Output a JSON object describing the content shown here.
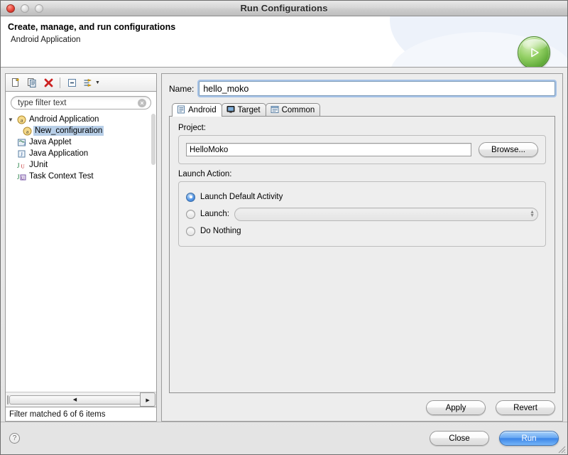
{
  "window": {
    "title": "Run Configurations",
    "controls": {
      "close": "close-button",
      "minimize": "minimize-button",
      "zoom": "zoom-button"
    }
  },
  "header": {
    "title": "Create, manage, and run configurations",
    "subtitle": "Android Application",
    "badge_icon": "run-play-icon"
  },
  "left_panel": {
    "toolbar": [
      {
        "name": "new-configuration-icon",
        "tooltip": "New launch configuration"
      },
      {
        "name": "duplicate-configuration-icon",
        "tooltip": "Duplicate"
      },
      {
        "name": "delete-configuration-icon",
        "tooltip": "Delete"
      },
      {
        "name": "collapse-all-icon",
        "tooltip": "Collapse All"
      },
      {
        "name": "filter-icon",
        "tooltip": "Filter"
      }
    ],
    "filter": {
      "placeholder": "type filter text",
      "value": "",
      "clear_icon": "clear-icon"
    },
    "tree": [
      {
        "label": "Android Application",
        "icon": "android-config-icon",
        "expanded": true,
        "indent": 0,
        "selected": false
      },
      {
        "label": "New_configuration",
        "icon": "android-config-icon",
        "expanded": false,
        "indent": 1,
        "selected": true
      },
      {
        "label": "Java Applet",
        "icon": "java-applet-icon",
        "expanded": false,
        "indent": 0,
        "selected": false
      },
      {
        "label": "Java Application",
        "icon": "java-application-icon",
        "expanded": false,
        "indent": 0,
        "selected": false
      },
      {
        "label": "JUnit",
        "icon": "junit-icon",
        "expanded": false,
        "indent": 0,
        "selected": false
      },
      {
        "label": "Task Context Test",
        "icon": "task-context-test-icon",
        "expanded": false,
        "indent": 0,
        "selected": false
      }
    ],
    "status": "Filter matched 6 of 6 items",
    "scroll_left_icon": "scroll-left-arrow",
    "scroll_right_icon": "scroll-right-arrow"
  },
  "right_panel": {
    "name_label": "Name:",
    "name_value": "hello_moko",
    "tabs": [
      {
        "label": "Android",
        "icon": "android-tab-icon",
        "active": true
      },
      {
        "label": "Target",
        "icon": "target-tab-icon",
        "active": false
      },
      {
        "label": "Common",
        "icon": "common-tab-icon",
        "active": false
      }
    ],
    "project": {
      "label": "Project:",
      "value": "HelloMoko",
      "browse_label": "Browse..."
    },
    "launch_action": {
      "label": "Launch Action:",
      "options": [
        {
          "label": "Launch Default Activity",
          "selected": true
        },
        {
          "label": "Launch:",
          "selected": false
        },
        {
          "label": "Do Nothing",
          "selected": false
        }
      ],
      "launch_combo_value": ""
    },
    "apply_label": "Apply",
    "revert_label": "Revert"
  },
  "footer": {
    "help_icon": "help-icon",
    "close_label": "Close",
    "run_label": "Run",
    "resize_grip": "resize-grip-icon"
  },
  "colors": {
    "selection_blue": "#b8cfe8",
    "default_button_blue": "#3c85e8",
    "run_green": "#63ad3b",
    "focus_ring": "#6ea0e1"
  }
}
